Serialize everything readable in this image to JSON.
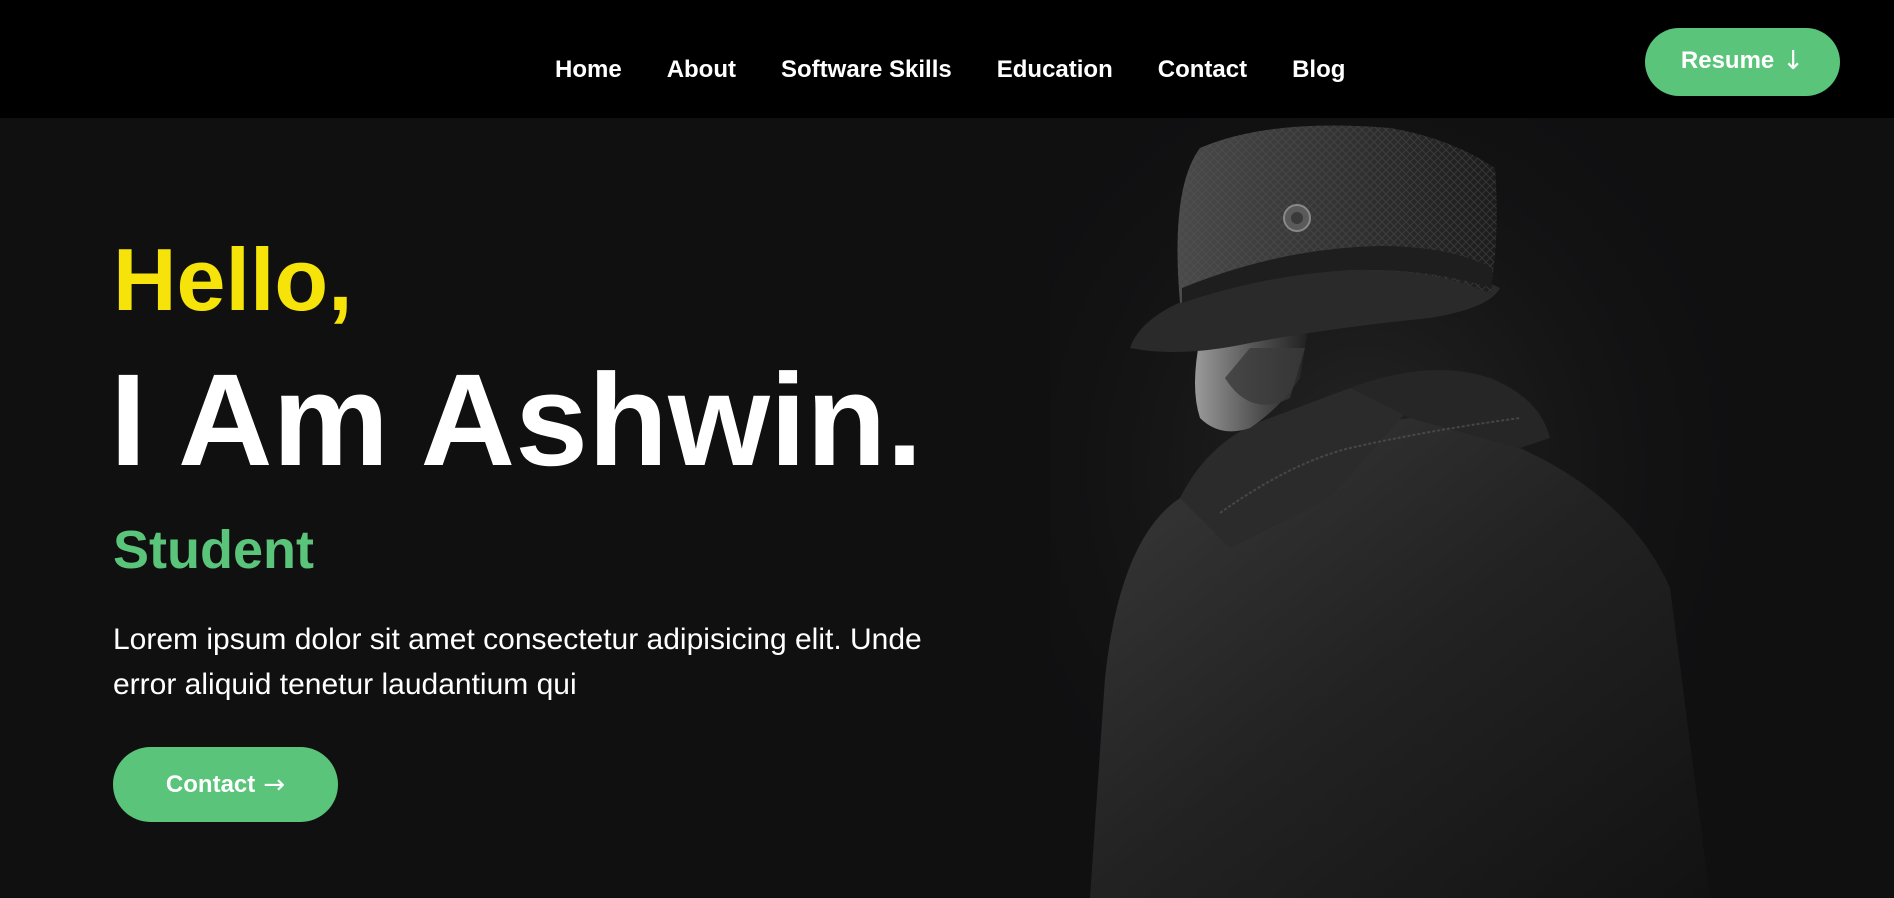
{
  "nav": {
    "links": [
      "Home",
      "About",
      "Software Skills",
      "Education",
      "Contact",
      "Blog"
    ],
    "resume_label": "Resume",
    "resume_icon": "arrow-down-icon"
  },
  "hero": {
    "greeting": "Hello,",
    "name": "I Am Ashwin.",
    "role": "Student",
    "description": "Lorem ipsum dolor sit amet consectetur adipisicing elit. Unde error aliquid tenetur laudantium qui",
    "contact_label": "Contact",
    "contact_icon": "arrow-right-icon"
  },
  "colors": {
    "background": "#101011",
    "navbar": "#000000",
    "accent_green": "#5ac47a",
    "accent_yellow": "#f5e30a",
    "text": "#ffffff"
  }
}
